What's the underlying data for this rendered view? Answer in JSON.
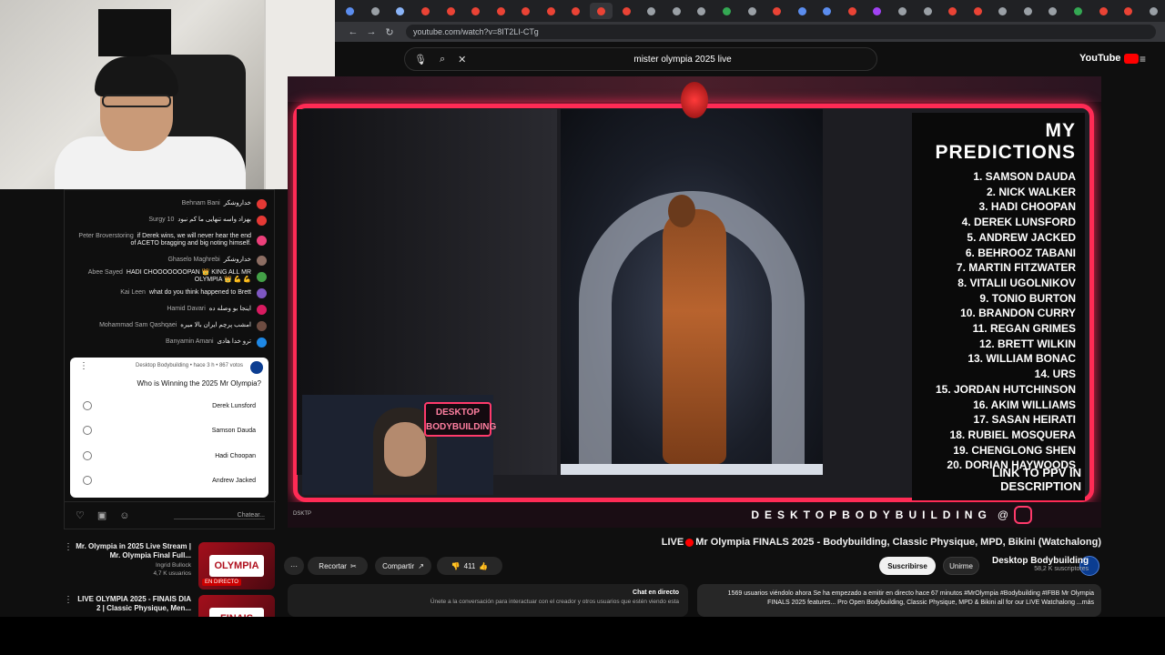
{
  "browser": {
    "url": "youtube.com/watch?v=8IT2LI-CTg",
    "tab_colors": [
      "#5b8def",
      "#9aa0a6",
      "#8ab4f8",
      "#ea4335",
      "#ea4335",
      "#ea4335",
      "#ea4335",
      "#ea4335",
      "#ea4335",
      "#ea4335",
      "#ea4335",
      "#ea4335",
      "#9aa0a6",
      "#9aa0a6",
      "#9aa0a6",
      "#34a853",
      "#9aa0a6",
      "#ea4335",
      "#5b8def",
      "#5b8def",
      "#ea4335",
      "#a142f4",
      "#9aa0a6",
      "#9aa0a6",
      "#ea4335",
      "#ea4335",
      "#9aa0a6",
      "#9aa0a6",
      "#9aa0a6",
      "#34a853",
      "#ea4335",
      "#ea4335",
      "#9aa0a6"
    ]
  },
  "search": {
    "query": "mister olympia 2025 live"
  },
  "youtube": {
    "logo_text": "YouTube"
  },
  "chat": {
    "messages": [
      {
        "author": "Behnam Bani",
        "text": "خداروشکر",
        "color": "#e53935"
      },
      {
        "author": "Surgy 10",
        "text": "بهزاد واسه تنهایی ما کم نبود",
        "color": "#e53935"
      },
      {
        "author": "Peter Broverstoring",
        "text": "if Derek wins, we will never hear the end of ACETO bragging and big noting himself.",
        "color": "#ec407a"
      },
      {
        "author": "Ghaselo Maghrebi",
        "text": "خداروشکر",
        "color": "#8d6e63"
      },
      {
        "author": "Abee Sayed",
        "text": "HADI CHOOOOOOOPAN 👑 KING ALL MR OLYMPIA 👑 💪 💪",
        "color": "#43a047"
      },
      {
        "author": "Kai Leen",
        "text": "what do you think happened to Brett",
        "color": "#7e57c2"
      },
      {
        "author": "Hamid Davari",
        "text": "اینجا بو وصله ده",
        "color": "#d81b60"
      },
      {
        "author": "Mohammad Sam Qashqaei",
        "text": "امشب پرچم ایران بالا میره",
        "color": "#6d4c41"
      },
      {
        "author": "Banyamin Amani",
        "text": "ترو خدا هادی",
        "color": "#1e88e5"
      }
    ],
    "poll": {
      "meta": "Desktop Bodybuilding • hace 3 h • 867 votos",
      "question": "Who is Winning the 2025 Mr Olympia?",
      "options": [
        "Derek Lunsford",
        "Samson Dauda",
        "Hadi Choopan",
        "Andrew Jacked"
      ]
    },
    "input_placeholder": "Chatear..."
  },
  "video": {
    "predictions_title": "MY PREDICTIONS",
    "predictions": [
      "1. SAMSON DAUDA",
      "2. NICK WALKER",
      "3. HADI CHOOPAN",
      "4. DEREK LUNSFORD",
      "5. ANDREW JACKED",
      "6. BEHROOZ TABANI",
      "7. MARTIN FITZWATER",
      "8. VITALII UGOLNIKOV",
      "9. TONIO BURTON",
      "10. BRANDON CURRY",
      "11. REGAN GRIMES",
      "12. BRETT WILKIN",
      "13. WILLIAM BONAC",
      "14. URS",
      "15. JORDAN HUTCHINSON",
      "16. AKIM WILLIAMS",
      "17. SASAN HEIRATI",
      "18. RUBIEL MOSQUERA",
      "19. CHENGLONG SHEN",
      "20. DORIAN HAYWOODS"
    ],
    "predictions_footer": "LINK TO PPV IN DESCRIPTION",
    "handle": "DESKTOPBODYBUILDING",
    "brand_overlay": "DESKTOP BODYBUILDING",
    "corner_label": "DSKTP"
  },
  "title": {
    "prefix": "LIVE",
    "text": "Mr Olympia FINALS 2025 - Bodybuilding, Classic Physique, MPD, Bikini (Watchalong)"
  },
  "channel": {
    "name": "Desktop Bodybuilding",
    "subs": "58,2 K suscriptores"
  },
  "actions": {
    "subscribe": "Suscribirse",
    "join": "Unirme",
    "likes": "411",
    "share": "Compartir",
    "clip": "Recortar",
    "more": "···"
  },
  "description": "1569 usuarios viéndolo ahora  Se ha empezado a emitir en directo hace 67 minutos  #MrOlympia #Bodybuilding #IFBB Mr Olympia FINALS 2025 features... Pro Open Bodybuilding, Classic Physique, MPD & Bikini all for our LIVE Watchalong ...más",
  "live_chat": {
    "heading": "Chat en directo",
    "subtext": "Únete a la conversación para interactuar con el creador y otros usuarios que estén viendo esta"
  },
  "related": [
    {
      "title": "Mr. Olympia in 2025 Live Stream | Mr. Olympia Final Full...",
      "channel": "Ingrid Bullock",
      "views": "4,7 K usuarios",
      "thumb_text": "OLYMPIA",
      "tag": "EN DIRECTO"
    },
    {
      "title": "LIVE OLYMPIA 2025 - FINAIS DIA 2 | Classic Physique, Men...",
      "channel": "",
      "views": "",
      "thumb_text": "FINAIS",
      "tag": ""
    }
  ]
}
